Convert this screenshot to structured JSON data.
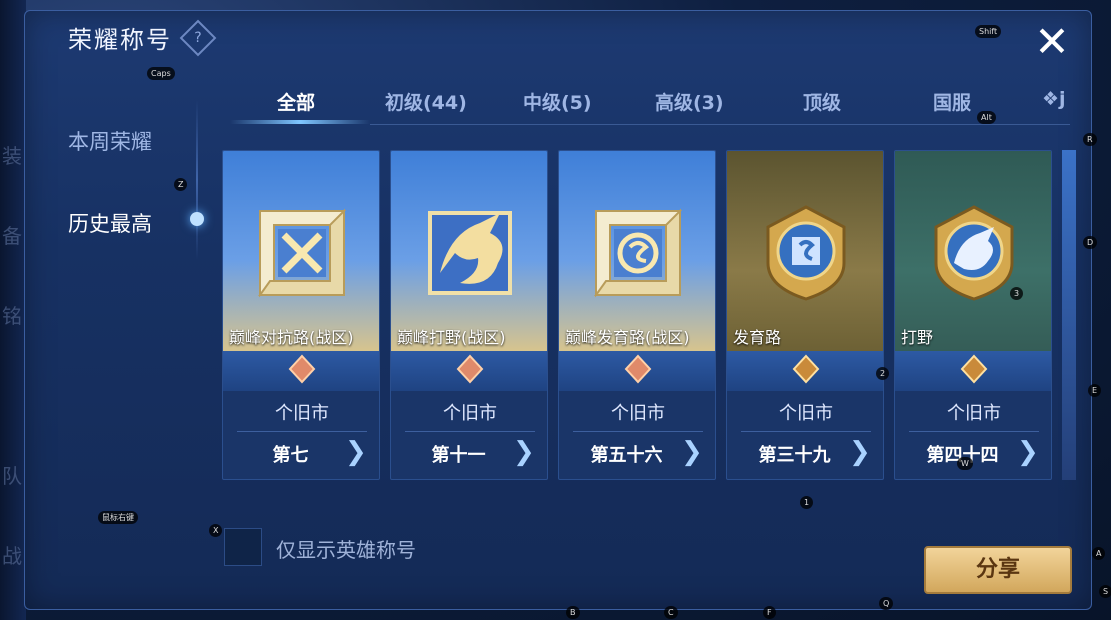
{
  "window": {
    "title": "荣耀称号",
    "help_icon": "?",
    "close_icon": "✕"
  },
  "side_tabs": [
    {
      "label": "本周荣耀",
      "active": false
    },
    {
      "label": "历史最高",
      "active": true
    }
  ],
  "tabs": [
    {
      "label": "全部",
      "active": true
    },
    {
      "label": "初级(44)"
    },
    {
      "label": "中级(5)"
    },
    {
      "label": "高级(3)"
    },
    {
      "label": "顶级"
    },
    {
      "label": "国服"
    },
    {
      "label": "❖j"
    }
  ],
  "cards": [
    {
      "name": "巅峰对抗路(战区)",
      "region": "个旧市",
      "rank": "第七",
      "emblem": "cross-swords",
      "theme": "blue"
    },
    {
      "name": "巅峰打野(战区)",
      "region": "个旧市",
      "rank": "第十一",
      "emblem": "dragon",
      "theme": "blue"
    },
    {
      "name": "巅峰发育路(战区)",
      "region": "个旧市",
      "rank": "第五十六",
      "emblem": "s-coin",
      "theme": "blue"
    },
    {
      "name": "发育路",
      "region": "个旧市",
      "rank": "第三十九",
      "emblem": "s-shield",
      "theme": "gold"
    },
    {
      "name": "打野",
      "region": "个旧市",
      "rank": "第四十四",
      "emblem": "dragon-shield",
      "theme": "green"
    }
  ],
  "filter": {
    "label": "仅显示英雄称号",
    "checked": false
  },
  "share_label": "分享",
  "key_hints": {
    "caps": "Caps",
    "shift": "Shift",
    "alt": "Alt",
    "z": "Z",
    "r": "R",
    "d": "D",
    "e": "E",
    "n3": "3",
    "n2": "2",
    "n1": "1",
    "w": "W",
    "x": "X",
    "mouse": "鼠标右键",
    "a": "A",
    "s": "S",
    "b": "B",
    "c": "C",
    "f": "F",
    "q": "Q"
  },
  "side_glyphs": [
    "装",
    "备",
    "铭",
    "队",
    "战"
  ]
}
